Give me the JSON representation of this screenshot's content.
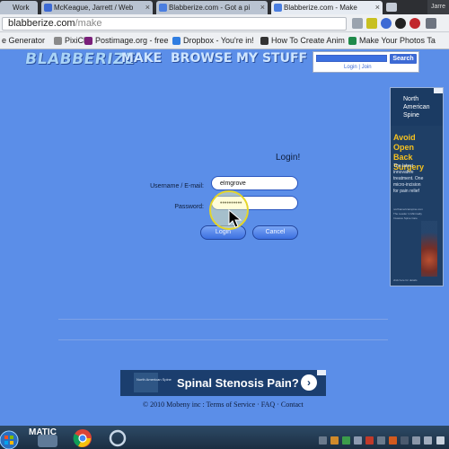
{
  "browser": {
    "tabs": [
      {
        "label": "Work",
        "active": false
      },
      {
        "label": "McKeague, Jarrett / Web",
        "active": false
      },
      {
        "label": "Blabberize.com - Got a pi",
        "active": false
      },
      {
        "label": "Blabberize.com - Make",
        "active": true
      }
    ],
    "window_control": "Jarre",
    "url_domain": "blabberize.com",
    "url_path": "/make",
    "bookmarks": [
      {
        "label": "e Generator",
        "icon_color": "#3d6ad4"
      },
      {
        "label": "PixiClip",
        "icon_color": "#8a8a8a"
      },
      {
        "label": "Postimage.org - free",
        "icon_color": "#7a1f7a"
      },
      {
        "label": "Dropbox - You're in!",
        "icon_color": "#2f7de1"
      },
      {
        "label": "How To Create Anim",
        "icon_color": "#333333"
      },
      {
        "label": "Make Your Photos Ta",
        "icon_color": "#1f8a4a"
      }
    ]
  },
  "site": {
    "logo_text": "BLABBERIZE",
    "nav": [
      "MAKE",
      "BROWSE",
      "MY STUFF"
    ],
    "search_button": "Search",
    "search_sublinks": "Login | Join"
  },
  "login": {
    "title": "Login!",
    "username_label": "Username / E-mail:",
    "username_value": "elmgrove",
    "password_label": "Password:",
    "password_value": "••••••••••",
    "login_button": "Login",
    "cancel_button": "Cancel"
  },
  "side_ad": {
    "brand": "North American Spine",
    "headline": "Avoid Open Back Surgery",
    "body": "The latest innovative treatment. One micro-incision for pain relief",
    "small": "northamericanspine.com The Leader in Minimally Invasive Spine Care",
    "foot": "click here for details"
  },
  "bottom_ad": {
    "brand": "North American Spine",
    "headline": "Spinal Stenosis Pain?",
    "arrow": "›"
  },
  "footer": {
    "copyright": "© 2010 Mobeny inc",
    "sep": " : ",
    "terms": "Terms of Service",
    "dot": " · ",
    "faq": "FAQ",
    "contact": "Contact"
  },
  "taskbar": {
    "start_label": "MATIC"
  },
  "colors": {
    "page_bg": "#5b8ee8",
    "accent": "#3d6ad4",
    "ad_yellow": "#f7c21e",
    "ad_navy": "#1b3e6e"
  }
}
